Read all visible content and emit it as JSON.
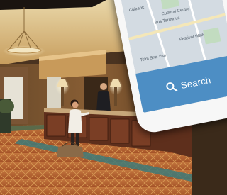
{
  "phone": {
    "map_labels": [
      "Citibank",
      "Cultural Centre",
      "Bus Terminus",
      "Festival Walk",
      "Tsim Sha Tsui"
    ],
    "search_label": "Search",
    "search_icon": "search-icon",
    "accent": "#4d8ec4"
  }
}
